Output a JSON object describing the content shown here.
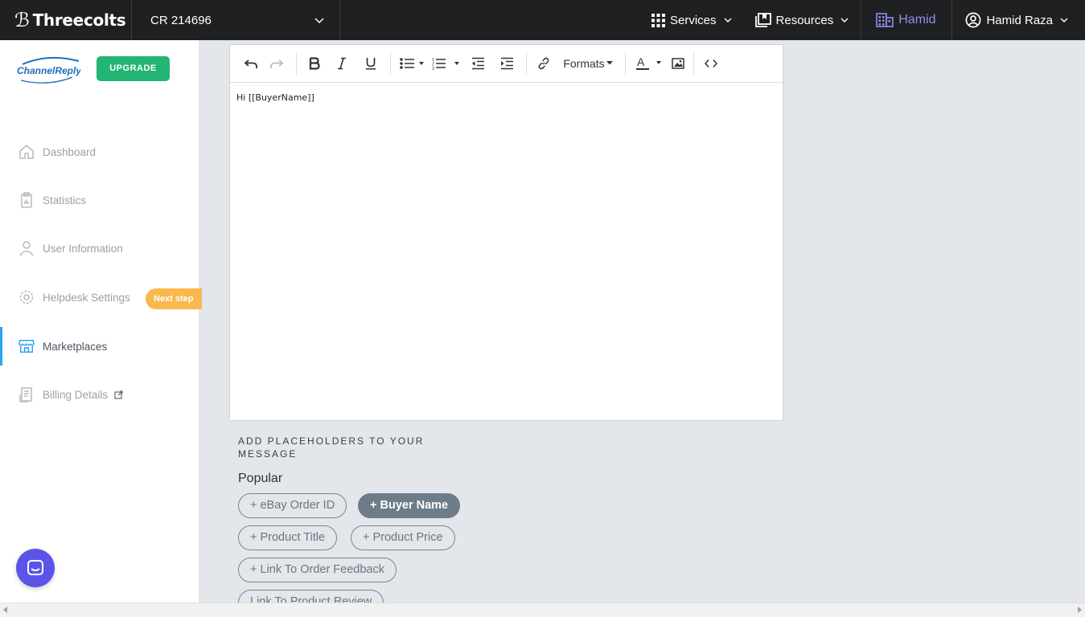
{
  "topbar": {
    "brand": "Threecolts",
    "account": "CR 214696",
    "nav": {
      "services": "Services",
      "resources": "Resources",
      "org": "Hamid",
      "user": "Hamid Raza"
    },
    "colors": {
      "bg": "#1f2021",
      "org": "#8f8ff5"
    }
  },
  "sidebar": {
    "logo_text": "ChannelReply",
    "upgrade_label": "UPGRADE",
    "next_step_badge": "Next step",
    "items": [
      {
        "label": "Dashboard",
        "icon": "home-icon"
      },
      {
        "label": "Statistics",
        "icon": "clipboard-chart-icon"
      },
      {
        "label": "User Information",
        "icon": "user-icon"
      },
      {
        "label": "Helpdesk Settings",
        "icon": "gear-icon"
      },
      {
        "label": "Marketplaces",
        "icon": "store-icon",
        "active": true
      },
      {
        "label": "Billing Details",
        "icon": "receipt-icon",
        "external": true
      }
    ],
    "colors": {
      "active_bar": "#2aa4f4",
      "upgrade": "#22b573",
      "badge": "#f8b84e"
    }
  },
  "editor": {
    "toolbar": {
      "formats_label": "Formats"
    },
    "content": "Hi [[BuyerName]]"
  },
  "placeholders": {
    "title": "ADD PLACEHOLDERS TO YOUR MESSAGE",
    "section": "Popular",
    "chips": [
      {
        "label": "+ eBay Order ID",
        "selected": false
      },
      {
        "label": "+ Buyer Name",
        "selected": true
      },
      {
        "label": "+ Product Title",
        "selected": false
      },
      {
        "label": "+ Product Price",
        "selected": false
      },
      {
        "label": "+ Link To Order Feedback",
        "selected": false
      },
      {
        "label": "Link To Product Review",
        "selected": false
      }
    ]
  }
}
